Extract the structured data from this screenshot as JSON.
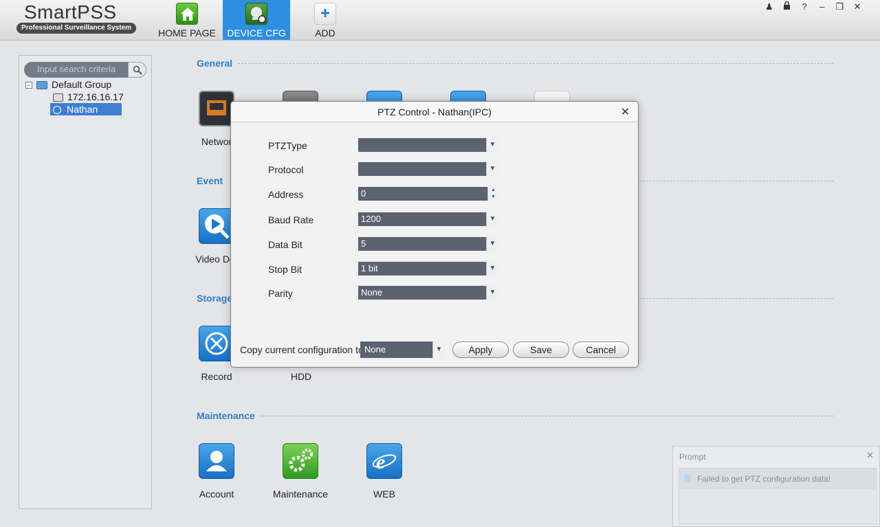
{
  "app": {
    "logo_text": "SmartPSS",
    "logo_sub": "Professional Surveillance System"
  },
  "nav": [
    {
      "label": "HOME PAGE",
      "icon": "home-icon"
    },
    {
      "label": "DEVICE CFG",
      "icon": "device-cfg-icon",
      "active": true
    },
    {
      "label": "ADD",
      "icon": "plus-icon",
      "glyph": "+"
    }
  ],
  "window_controls": [
    "user-icon",
    "lock-icon",
    "help-icon",
    "minimize-icon",
    "restore-icon",
    "close-icon"
  ],
  "window_glyphs": {
    "user": "♟",
    "lock": "🔒",
    "help": "?",
    "minimize": "–",
    "restore": "❐",
    "close": "✕"
  },
  "sidebar": {
    "search_placeholder": "Input search criteria",
    "tree": {
      "group": "Default Group",
      "items": [
        "172.16.16.17",
        "Nathan"
      ]
    }
  },
  "sections": {
    "general": "General",
    "event": "Event",
    "storage": "Storage",
    "maintenance": "Maintenance"
  },
  "tiles": {
    "network": "Networ",
    "video_detect": "Video Det",
    "record": "Record",
    "hdd": "HDD",
    "account": "Account",
    "maintenance": "Maintenance",
    "web": "WEB"
  },
  "dialog": {
    "title": "PTZ Control - Nathan(IPC)",
    "close_glyph": "✕",
    "fields": [
      {
        "label": "PTZType",
        "value": ""
      },
      {
        "label": "Protocol",
        "value": ""
      },
      {
        "label": "Address",
        "value": "0"
      },
      {
        "label": "Baud Rate",
        "value": "1200"
      },
      {
        "label": "Data Bit",
        "value": "5"
      },
      {
        "label": "Stop Bit",
        "value": "1 bit"
      },
      {
        "label": "Parity",
        "value": "None"
      }
    ],
    "copy_label": "Copy current configuration to",
    "copy_value": "None",
    "buttons": {
      "apply": "Apply",
      "save": "Save",
      "cancel": "Cancel"
    }
  },
  "prompt": {
    "title": "Prompt",
    "close_glyph": "✕",
    "message": "Failed to get PTZ configuration data!"
  }
}
